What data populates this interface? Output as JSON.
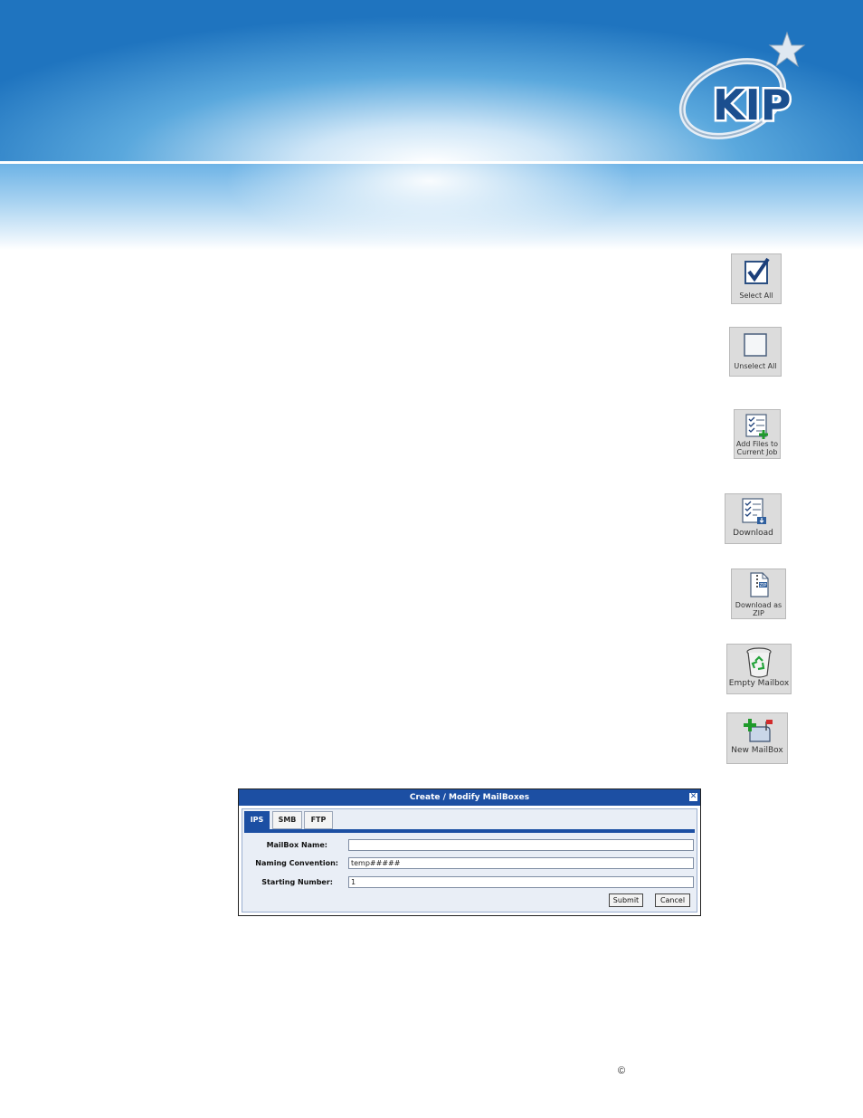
{
  "header": {
    "logo_text": "KIP"
  },
  "toolbar": {
    "select_all": "Select All",
    "unselect_all": "Unselect All",
    "add_files_line1": "Add Files to",
    "add_files_line2": "Current Job",
    "download": "Download",
    "download_zip_line1": "Download as",
    "download_zip_line2": "ZIP",
    "empty_mailbox": "Empty Mailbox",
    "new_mailbox": "New MailBox"
  },
  "dialog": {
    "title": "Create / Modify MailBoxes",
    "close_glyph": "✕",
    "tabs": [
      {
        "label": "IPS",
        "active": true
      },
      {
        "label": "SMB",
        "active": false
      },
      {
        "label": "FTP",
        "active": false
      }
    ],
    "fields": {
      "mailbox_name_label": "MailBox Name:",
      "mailbox_name_value": "",
      "naming_convention_label": "Naming Convention:",
      "naming_convention_value": "temp#####",
      "starting_number_label": "Starting Number:",
      "starting_number_value": "1"
    },
    "submit_label": "Submit",
    "cancel_label": "Cancel"
  },
  "footer": {
    "copyright_symbol": "©"
  },
  "colors": {
    "dialog_accent": "#1c4fa3",
    "banner_blue": "#1f74bf",
    "button_gray": "#dcdcdc"
  }
}
